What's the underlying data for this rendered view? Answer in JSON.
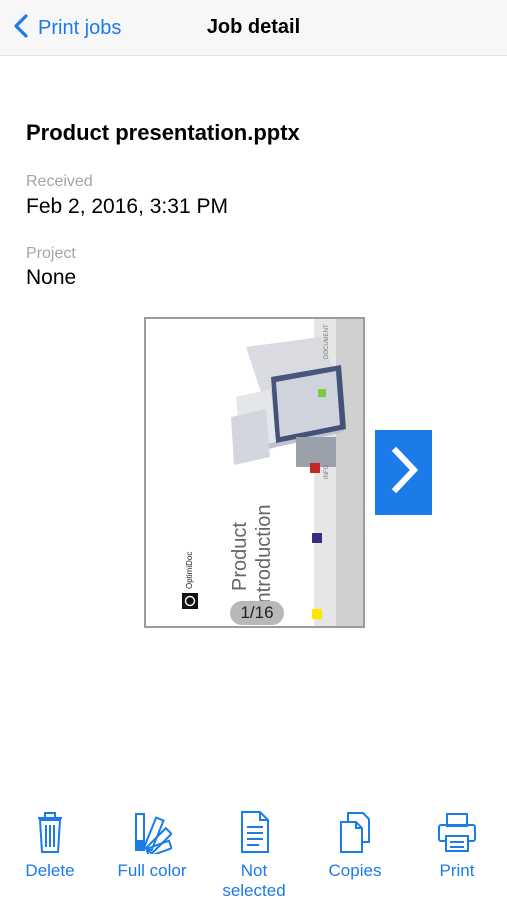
{
  "navbar": {
    "back_label": "Print jobs",
    "title": "Job detail"
  },
  "job": {
    "file_name": "Product presentation.pptx",
    "received_label": "Received",
    "received_value": "Feb 2, 2016, 3:31 PM",
    "project_label": "Project",
    "project_value": "None"
  },
  "preview": {
    "page_counter": "1/16",
    "slide_title_line1": "Product",
    "slide_title_line2": "Introduction",
    "brand": "OptimiDoc"
  },
  "toolbar": {
    "delete_label": "Delete",
    "color_label": "Full color",
    "duplex_label_line1": "Not",
    "duplex_label_line2": "selected",
    "copies_label": "Copies",
    "print_label": "Print"
  },
  "colors": {
    "accent": "#1b7be8",
    "secondary_text": "#a5a5a5"
  },
  "icons": [
    "chevron-left-icon",
    "chevron-right-icon",
    "trash-icon",
    "color-palette-icon",
    "document-icon",
    "copies-icon",
    "printer-icon"
  ]
}
